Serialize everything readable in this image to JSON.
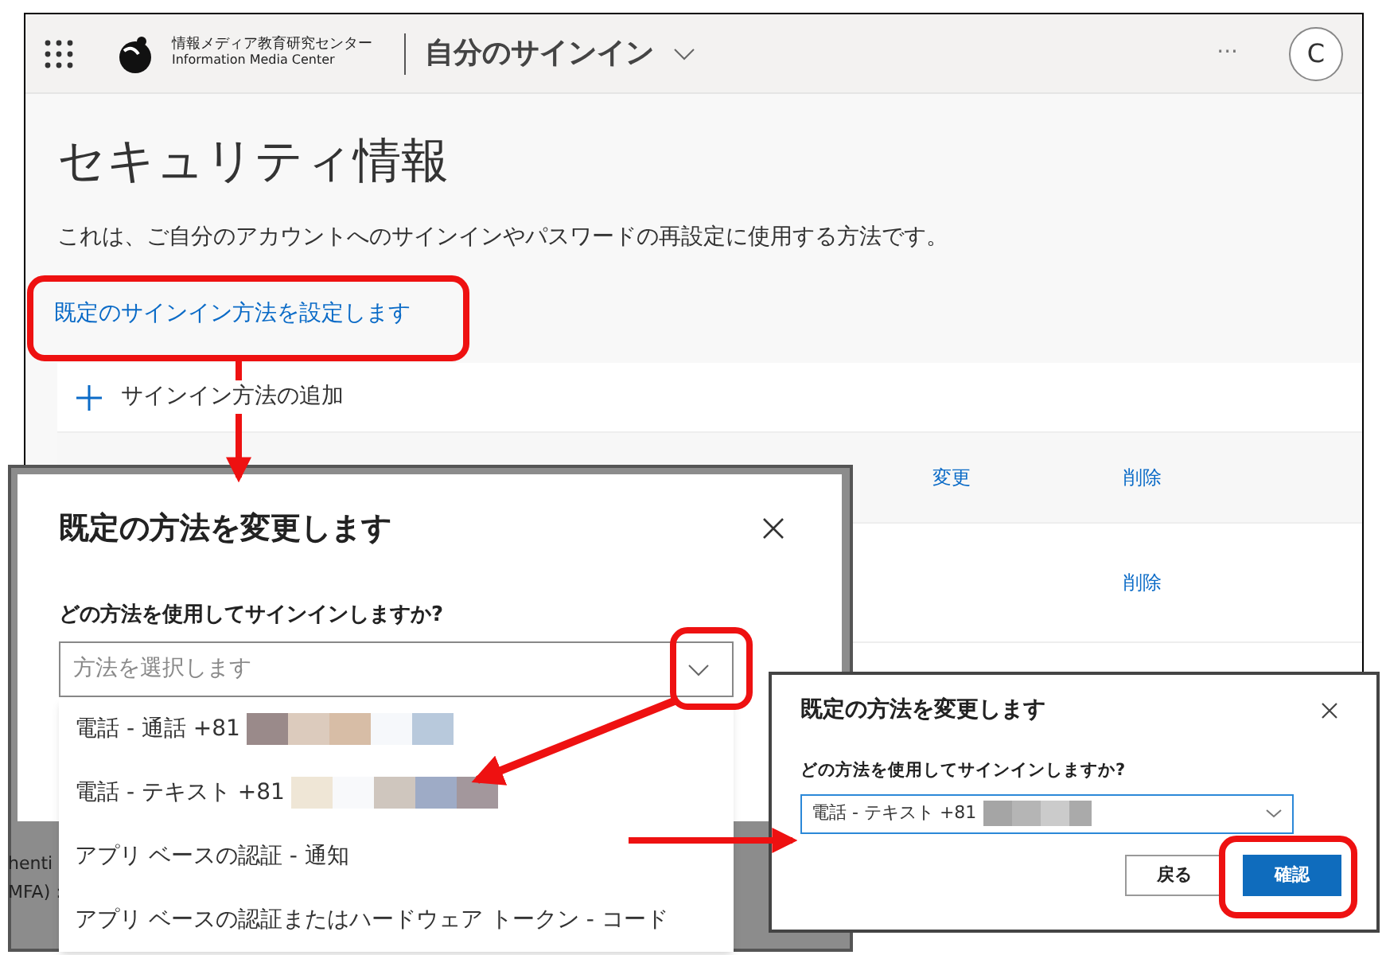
{
  "header": {
    "logo_text_ja": "情報メディア教育研究センター",
    "logo_text_en": "Information Media Center",
    "app_title": "自分のサインイン",
    "more": "···",
    "avatar": "C"
  },
  "page": {
    "title": "セキュリティ情報",
    "description": "これは、ご自分のアカウントへのサインインやパスワードの再設定に使用する方法です。",
    "default_link": "既定のサインイン方法を設定します"
  },
  "methods": {
    "add_label": "サインイン方法の追加",
    "rows": [
      {
        "change": "変更",
        "delete": "削除"
      },
      {
        "delete": "削除"
      }
    ]
  },
  "background_fragments": [
    "henti",
    "MFA) :"
  ],
  "dialog": {
    "title": "既定の方法を変更します",
    "question": "どの方法を使用してサインインしますか?",
    "placeholder": "方法を選択します",
    "options": [
      {
        "label": "電話 - 通話 +81",
        "redacted": true
      },
      {
        "label": "電話 - テキスト +81",
        "redacted": true
      },
      {
        "label": "アプリ ベースの認証 - 通知",
        "redacted": false
      },
      {
        "label": "アプリ ベースの認証またはハードウェア トークン - コード",
        "redacted": false
      }
    ]
  },
  "dialog_confirm": {
    "title": "既定の方法を変更します",
    "question": "どの方法を使用してサインインしますか?",
    "value": "電話 - テキスト +81",
    "buttons": [
      {
        "label": "戻る",
        "kind": "secondary"
      },
      {
        "label": "確認",
        "kind": "primary"
      }
    ]
  }
}
